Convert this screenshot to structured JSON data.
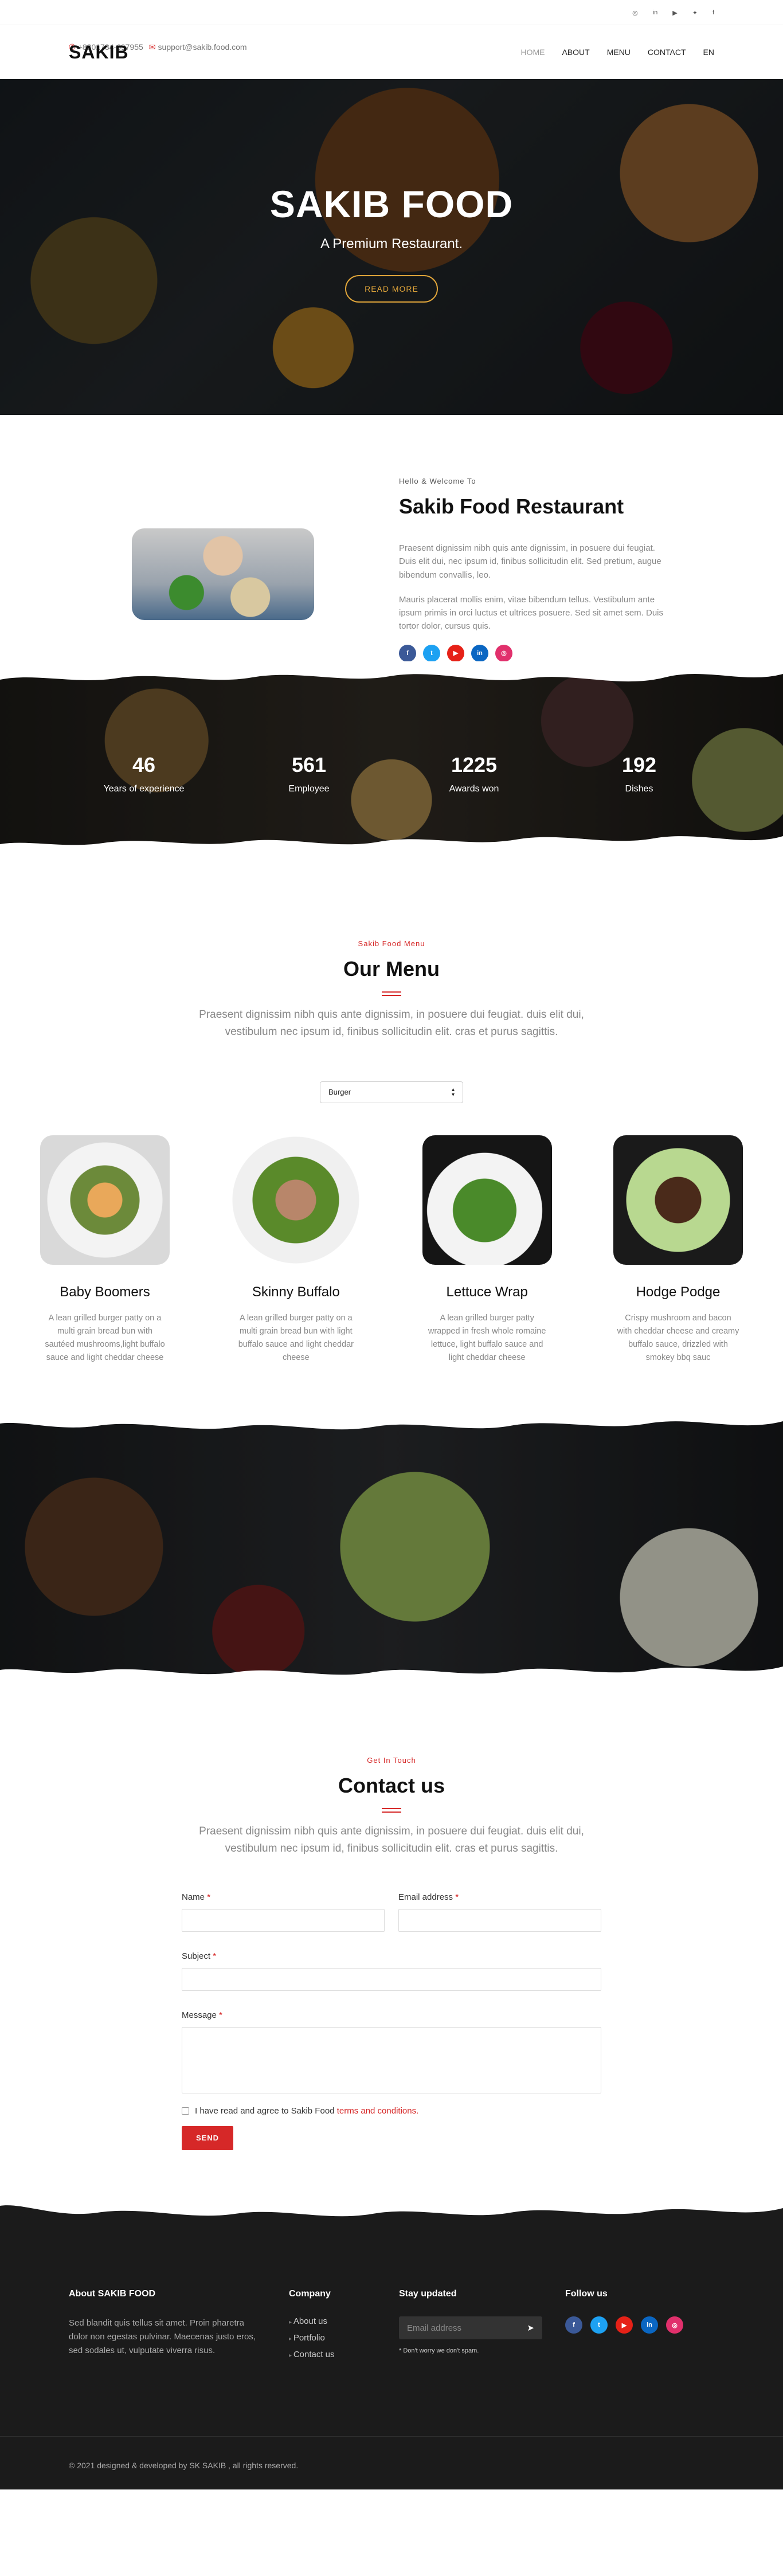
{
  "topbar": {
    "phone": "+8801784-697955",
    "email": "support@sakib.food.com",
    "social_icons": [
      "instagram-icon",
      "linkedin-icon",
      "youtube-icon",
      "twitter-icon",
      "facebook-icon"
    ],
    "social_glyphs": [
      "◎",
      "in",
      "▶",
      "✦",
      "f"
    ]
  },
  "nav": {
    "logo": "SAKIB",
    "items": [
      "HOME",
      "ABOUT",
      "MENU",
      "CONTACT",
      "EN"
    ]
  },
  "hero": {
    "title": "SAKIB FOOD",
    "subtitle": "A Premium Restaurant.",
    "button": "READ MORE"
  },
  "about": {
    "kicker": "Hello & Welcome To",
    "title": "Sakib Food Restaurant",
    "para1": "Praesent dignissim nibh quis ante dignissim, in posuere dui feugiat. Duis elit dui, nec ipsum id, finibus sollicitudin elit. Sed pretium, augue bibendum convallis, leo.",
    "para2": "Mauris placerat mollis enim, vitae bibendum tellus. Vestibulum ante ipsum primis in orci luctus et ultrices posuere. Sed sit amet sem. Duis tortor dolor, cursus quis.",
    "social": [
      {
        "name": "facebook-icon",
        "glyph": "f",
        "color": "#3b5998"
      },
      {
        "name": "twitter-icon",
        "glyph": "t",
        "color": "#1da1f2"
      },
      {
        "name": "youtube-icon",
        "glyph": "▶",
        "color": "#e62117"
      },
      {
        "name": "linkedin-icon",
        "glyph": "in",
        "color": "#0a66c2"
      },
      {
        "name": "instagram-icon",
        "glyph": "◎",
        "color": "#e1306c"
      }
    ]
  },
  "stats": [
    {
      "num": "46",
      "label": "Years of experience"
    },
    {
      "num": "561",
      "label": "Employee"
    },
    {
      "num": "1225",
      "label": "Awards won"
    },
    {
      "num": "192",
      "label": "Dishes"
    }
  ],
  "menu": {
    "kicker": "Sakib Food Menu",
    "title": "Our Menu",
    "intro": "Praesent dignissim nibh quis ante dignissim, in posuere dui feugiat. duis elit dui, vestibulum nec ipsum id, finibus sollicitudin elit. cras et purus sagittis.",
    "select_value": "Burger",
    "items": [
      {
        "title": "Baby Boomers",
        "desc": "A lean grilled burger patty on a multi grain bread bun with sautéed mushrooms,light buffalo sauce and light cheddar cheese"
      },
      {
        "title": "Skinny Buffalo",
        "desc": "A lean grilled burger patty on a multi grain bread bun with light buffalo sauce and light cheddar cheese"
      },
      {
        "title": "Lettuce Wrap",
        "desc": "A lean grilled burger patty wrapped in fresh whole romaine lettuce, light buffalo sauce and light cheddar cheese"
      },
      {
        "title": "Hodge Podge",
        "desc": "Crispy mushroom and bacon with cheddar cheese and creamy buffalo sauce, drizzled with smokey bbq sauc"
      }
    ]
  },
  "contact": {
    "kicker": "Get In Touch",
    "title": "Contact us",
    "intro": "Praesent dignissim nibh quis ante dignissim, in posuere dui feugiat. duis elit dui, vestibulum nec ipsum id, finibus sollicitudin elit. cras et purus sagittis.",
    "name_label": "Name",
    "email_label": "Email address",
    "subject_label": "Subject",
    "message_label": "Message",
    "required_mark": "*",
    "agree_text": "I have read and agree to Sakib Food",
    "agree_link": "terms and conditions.",
    "send": "SEND"
  },
  "footer": {
    "about_title": "About SAKIB FOOD",
    "about_text": "Sed blandit quis tellus sit amet. Proin pharetra dolor non egestas pulvinar. Maecenas justo eros, sed sodales ut, vulputate viverra risus.",
    "company_title": "Company",
    "company_links": [
      "About us",
      "Portfolio",
      "Contact us"
    ],
    "updates_title": "Stay updated",
    "email_placeholder": "Email address",
    "note": "* Don't worry we don't spam.",
    "follow_title": "Follow us",
    "copyright": "© 2021 designed & developed by SK SAKIB , all rights reserved."
  }
}
